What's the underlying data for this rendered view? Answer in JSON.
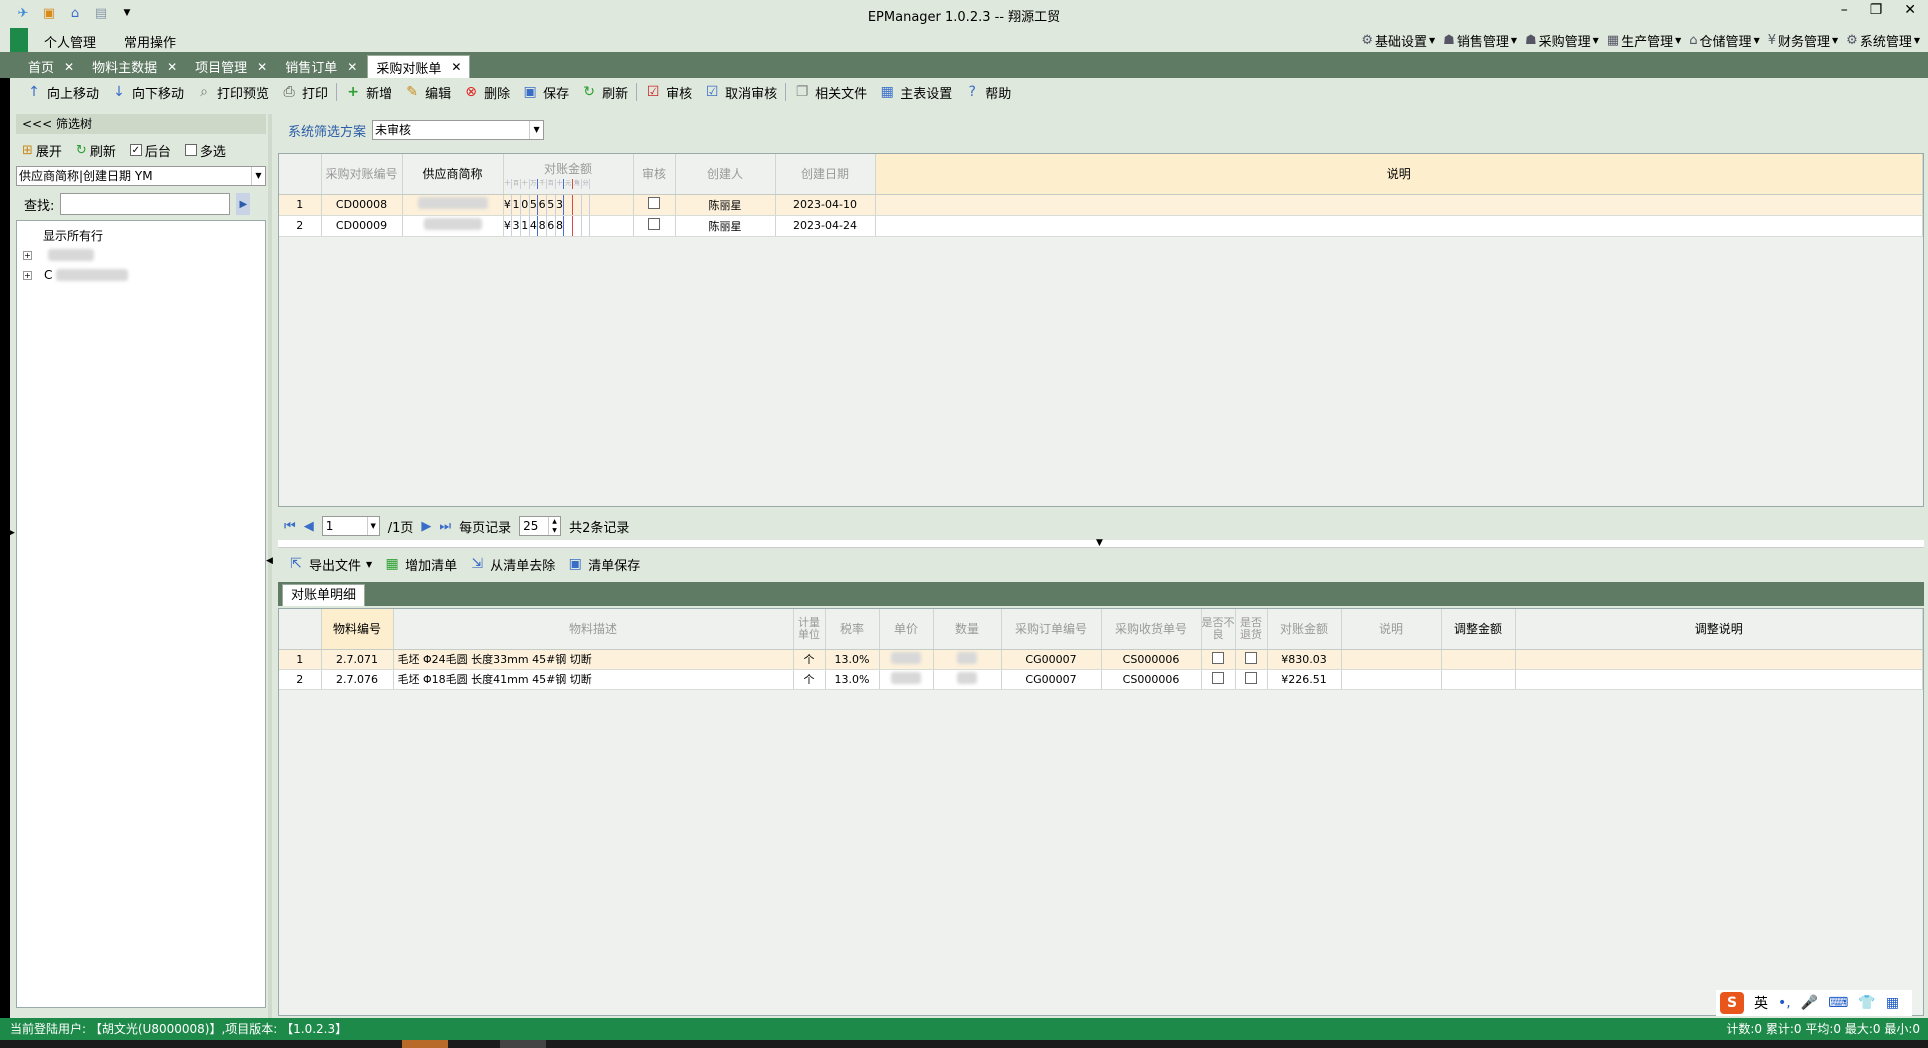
{
  "window": {
    "title": "EPManager 1.0.2.3 -- 翔源工贸",
    "controls": [
      "–",
      "❐",
      "✕"
    ]
  },
  "menubar": {
    "left": [
      "个人管理",
      "常用操作"
    ],
    "right": [
      "基础设置",
      "销售管理",
      "采购管理",
      "生产管理",
      "仓储管理",
      "财务管理",
      "系统管理"
    ]
  },
  "tabs": [
    "首页",
    "物料主数据",
    "项目管理",
    "销售订单",
    "采购对账单"
  ],
  "active_tab": "采购对账单",
  "toolbar": {
    "move_up": "向上移动",
    "move_down": "向下移动",
    "print_preview": "打印预览",
    "print": "打印",
    "add": "新增",
    "edit": "编辑",
    "delete": "删除",
    "save": "保存",
    "refresh": "刷新",
    "audit": "审核",
    "cancel_audit": "取消审核",
    "related_files": "相关文件",
    "main_settings": "主表设置",
    "help": "帮助"
  },
  "left_panel": {
    "header": "<<< 筛选树",
    "expand": "展开",
    "refresh": "刷新",
    "backend": "后台",
    "multi": "多选",
    "grouping": "供应商简称|创建日期 YM",
    "find_label": "查找:",
    "tree_root": "显示所有行",
    "tree_nodes": [
      "",
      "C"
    ]
  },
  "filter": {
    "label": "系统筛选方案",
    "value": "未审核"
  },
  "grid1": {
    "columns": {
      "no": "采购对账编号",
      "supplier": "供应商简称",
      "amount": "对账金额",
      "audited": "审核",
      "creator": "创建人",
      "date": "创建日期",
      "note": "说明"
    },
    "amount_units": [
      "十",
      "百",
      "十",
      "万",
      "千",
      "百",
      "十",
      "元",
      "角",
      "分"
    ],
    "rows": [
      {
        "idx": "1",
        "no": "CD00008",
        "amount_digits": [
          "¥",
          "1",
          "0",
          "5",
          "6",
          "5",
          "3"
        ],
        "creator": "陈丽星",
        "date": "2023-04-10"
      },
      {
        "idx": "2",
        "no": "CD00009",
        "amount_digits": [
          "¥",
          "3",
          "1",
          "4",
          "8",
          "6",
          "8"
        ],
        "creator": "陈丽星",
        "date": "2023-04-24"
      }
    ]
  },
  "pager": {
    "page": "1",
    "total_pages": "/1页",
    "per_page_label": "每页记录",
    "per_page": "25",
    "total": "共2条记录"
  },
  "toolbar2": {
    "export": "导出文件",
    "add_list": "增加清单",
    "remove_list": "从清单去除",
    "save_list": "清单保存"
  },
  "detail_tab": "对账单明细",
  "grid2": {
    "columns": {
      "code": "物料编号",
      "desc": "物料描述",
      "unit": "计量单位",
      "tax": "税率",
      "price": "单价",
      "qty": "数量",
      "order_no": "采购订单编号",
      "recv_no": "采购收货单号",
      "c1": "是否不良",
      "c2": "是否退货",
      "amount": "对账金额",
      "note": "说明",
      "adj_amount": "调整金额",
      "adj_note": "调整说明"
    },
    "rows": [
      {
        "idx": "1",
        "code": "2.7.071",
        "desc": "毛坯 Φ24毛圆 长度33mm 45#钢 切断",
        "unit": "个",
        "tax": "13.0%",
        "order_no": "CG00007",
        "recv_no": "CS000006",
        "amount": "¥830.03"
      },
      {
        "idx": "2",
        "code": "2.7.076",
        "desc": "毛坯 Φ18毛圆 长度41mm 45#钢 切断",
        "unit": "个",
        "tax": "13.0%",
        "order_no": "CG00007",
        "recv_no": "CS000006",
        "amount": "¥226.51"
      }
    ]
  },
  "status": {
    "user": "当前登陆用户: 【胡文光(U8000008)】,项目版本: 【1.0.2.3】",
    "stats": "计数:0 累计:0 平均:0 最大:0 最小:0"
  },
  "ime": {
    "lang": "英"
  }
}
